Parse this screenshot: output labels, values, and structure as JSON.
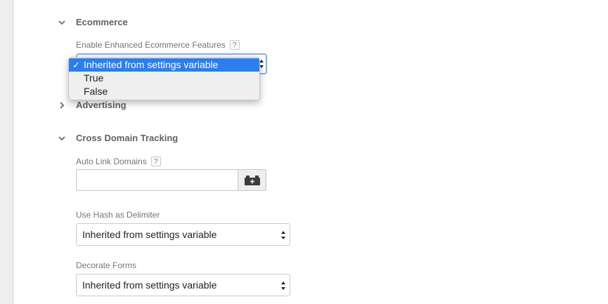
{
  "sections": {
    "ecommerce": {
      "title": "Ecommerce",
      "enhanced_label": "Enable Enhanced Ecommerce Features",
      "help": "?",
      "selected_value": "Inherited from settings variable",
      "options": [
        "Inherited from settings variable",
        "True",
        "False"
      ],
      "check": "✓"
    },
    "advertising": {
      "title": "Advertising"
    },
    "cross_domain": {
      "title": "Cross Domain Tracking",
      "auto_link_label": "Auto Link Domains",
      "help": "?",
      "auto_link_value": "",
      "use_hash_label": "Use Hash as Delimiter",
      "use_hash_value": "Inherited from settings variable",
      "decorate_forms_label": "Decorate Forms",
      "decorate_forms_value": "Inherited from settings variable"
    }
  },
  "icons": {
    "collapse": "chevron-down-icon",
    "expand": "chevron-right-icon",
    "variable_picker": "variable-brick-icon",
    "select_arrows": "select-arrows-icon"
  },
  "colors": {
    "accent": "#2a7ef0",
    "focus_ring": "#7fb3f0"
  }
}
